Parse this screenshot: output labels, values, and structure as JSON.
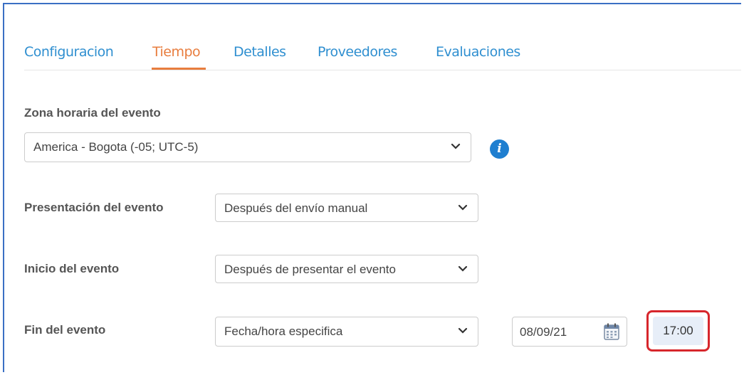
{
  "tabs": [
    {
      "label": "Configuracion"
    },
    {
      "label": "Tiempo"
    },
    {
      "label": "Detalles"
    },
    {
      "label": "Proveedores"
    },
    {
      "label": "Evaluaciones"
    }
  ],
  "active_tab": "Tiempo",
  "timezone": {
    "label": "Zona horaria del evento",
    "value": "America - Bogota (-05; UTC-5)",
    "info_icon": "info-icon"
  },
  "presentation": {
    "label": "Presentación del evento",
    "value": "Después del envío manual"
  },
  "start": {
    "label": "Inicio del evento",
    "value": "Después de presentar el evento"
  },
  "end": {
    "label": "Fin del evento",
    "value": "Fecha/hora especifica",
    "date": "08/09/21",
    "time": "17:00"
  },
  "colors": {
    "tab": "#2f8fd0",
    "tab_active": "#e87d3e",
    "highlight": "#d7262c",
    "frame": "#3b6fc4"
  }
}
